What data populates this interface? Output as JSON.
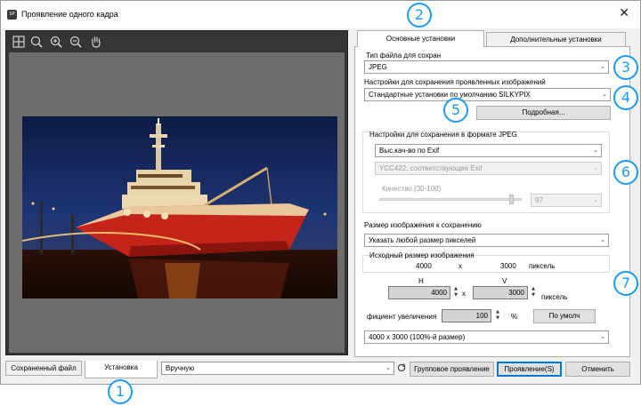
{
  "window": {
    "title": "Проявление одного кадра",
    "close_glyph": "✕",
    "app_icon_text": "SP"
  },
  "preview_toolbar": {
    "icons": [
      "grid-icon",
      "zoom-fit-icon",
      "zoom-in-icon",
      "zoom-out-icon",
      "hand-icon"
    ]
  },
  "tabs": {
    "main": "Основные установки",
    "additional": "Дополнительные установки"
  },
  "settings": {
    "file_type_label": "Тип файла для сохран",
    "file_type_value": "JPEG",
    "save_settings_label": "Настройки для сохранения проявленных изображений",
    "save_settings_value": "Стандартные установки по умолчанию SILKYPIX",
    "details_button": "Подробная...",
    "jpeg_group_label": "Настройки для сохранения в формате JPEG",
    "quality_mode_value": "Выс.кач-во по Exif",
    "ycc_value": "YCC422, соответствующее Exif",
    "quality_label": "Качество (30-100)",
    "quality_value": "97",
    "size_label": "Размер изображения к сохранению",
    "size_mode_value": "Указать любой размер пикселей",
    "original_size_label": "Исходный размер изображения",
    "orig_width": "4000",
    "orig_x": "x",
    "orig_height": "3000",
    "orig_unit": "пиксель",
    "h_label": "H",
    "v_label": "V",
    "h_value": "4000",
    "v_value": "3000",
    "new_x": "x",
    "new_unit": "пиксель",
    "scale_label": "фициент увеличения",
    "scale_value": "100",
    "scale_unit": "%",
    "default_button": "По умолч",
    "preset_size_value": "4000 x 3000  (100%-й размер)"
  },
  "bottom": {
    "saved_file_tab": "Сохраненный файл",
    "settings_tab": "Установка",
    "mode_value": "Вручную",
    "batch_button": "Групповое проявление",
    "develop_button": "Проявление(S)",
    "cancel_button": "Отменить"
  },
  "badges": [
    "1",
    "2",
    "3",
    "4",
    "5",
    "6",
    "7"
  ],
  "colors": {
    "badge": "#1d9bf0",
    "focus": "#0078d7",
    "preview_bg": "#6d6d6d",
    "toolbar_bg": "#353535"
  }
}
